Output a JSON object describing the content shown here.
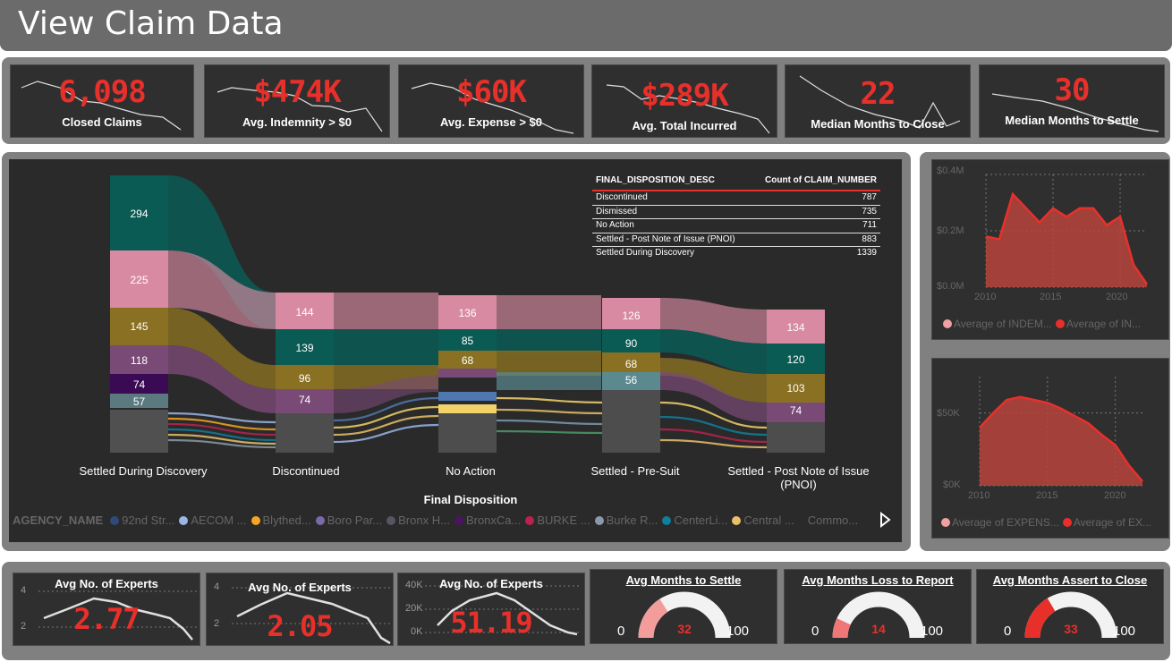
{
  "header": {
    "title": "View Claim Data"
  },
  "kpis": [
    {
      "value": "6,098",
      "label": "Closed Claims"
    },
    {
      "value": "$474K",
      "label": "Avg. Indemnity > $0"
    },
    {
      "value": "$60K",
      "label": "Avg. Expense > $0"
    },
    {
      "value": "$289K",
      "label": "Avg. Total Incurred"
    },
    {
      "value": "22",
      "label": "Median Months to Close"
    },
    {
      "value": "30",
      "label": "Median Months to Settle"
    }
  ],
  "sankey": {
    "x_axis_title": "Final Disposition",
    "columns": [
      "Settled During Discovery",
      "Discontinued",
      "No Action",
      "Settled - Pre-Suit",
      "Settled - Post Note of Issue (PNOI)"
    ],
    "node_values": {
      "col0": [
        "294",
        "225",
        "145",
        "118",
        "74",
        "57"
      ],
      "col1": [
        "144",
        "139",
        "96",
        "74"
      ],
      "col2": [
        "136",
        "85",
        "68"
      ],
      "col3": [
        "126",
        "90",
        "68",
        "56"
      ],
      "col4": [
        "134",
        "120",
        "103",
        "74"
      ]
    }
  },
  "disposition_table": {
    "headers": [
      "FINAL_DISPOSITION_DESC",
      "Count of CLAIM_NUMBER"
    ],
    "rows": [
      [
        "Discontinued",
        "787"
      ],
      [
        "Dismissed",
        "735"
      ],
      [
        "No Action",
        "711"
      ],
      [
        "Settled - Post Note of Issue (PNOI)",
        "883"
      ],
      [
        "Settled During Discovery",
        "1339"
      ]
    ]
  },
  "agency_legend": {
    "title": "AGENCY_NAME",
    "items": [
      {
        "label": "92nd Str...",
        "color": "#2e4a7a"
      },
      {
        "label": "AECOM ...",
        "color": "#9bb5e6"
      },
      {
        "label": "Blythed...",
        "color": "#f5a623"
      },
      {
        "label": "Boro Par...",
        "color": "#7a6aa8"
      },
      {
        "label": "Bronx H...",
        "color": "#555566"
      },
      {
        "label": "BronxCa...",
        "color": "#4b1463"
      },
      {
        "label": "BURKE ...",
        "color": "#b8234f"
      },
      {
        "label": "Burke R...",
        "color": "#8a9aa8"
      },
      {
        "label": "CenterLi...",
        "color": "#0e7f9c"
      },
      {
        "label": "Central ...",
        "color": "#e8c06a"
      }
    ],
    "more": "Commo..."
  },
  "chart_data": [
    {
      "type": "area",
      "x": [
        2010,
        2011,
        2012,
        2013,
        2014,
        2015,
        2016,
        2017,
        2018,
        2019,
        2020,
        2021,
        2022
      ],
      "series": [
        {
          "name": "Average of INDEM...",
          "values": [
            0.18,
            0.17,
            0.33,
            0.28,
            0.23,
            0.28,
            0.25,
            0.28,
            0.28,
            0.22,
            0.25,
            0.08,
            0.01
          ]
        },
        {
          "name": "Average of IN...",
          "values": [
            0.18,
            0.17,
            0.33,
            0.28,
            0.23,
            0.28,
            0.25,
            0.28,
            0.28,
            0.22,
            0.25,
            0.08,
            0.01
          ]
        }
      ],
      "y_tick_labels": [
        "$0.0M",
        "$0.2M",
        "$0.4M"
      ],
      "x_tick_labels": [
        "2010",
        "2015",
        "2020"
      ],
      "ylim": [
        0,
        0.4
      ],
      "xlim": [
        2010,
        2022
      ],
      "grid": true,
      "legend": "bottom"
    },
    {
      "type": "area",
      "x": [
        2010,
        2011,
        2012,
        2013,
        2014,
        2015,
        2016,
        2017,
        2018,
        2019,
        2020,
        2021,
        2022
      ],
      "series": [
        {
          "name": "Average of EXPENS...",
          "values": [
            40,
            50,
            59,
            61,
            59,
            57,
            53,
            48,
            43,
            35,
            28,
            14,
            3
          ]
        },
        {
          "name": "Average of EX...",
          "values": [
            40,
            50,
            59,
            61,
            59,
            57,
            53,
            48,
            43,
            35,
            28,
            14,
            3
          ]
        }
      ],
      "y_tick_labels": [
        "$0K",
        "$50K"
      ],
      "x_tick_labels": [
        "2010",
        "2015",
        "2020"
      ],
      "ylim": [
        0,
        75
      ],
      "xlim": [
        2010,
        2022
      ],
      "grid": true,
      "legend": "bottom"
    }
  ],
  "expert_minis": [
    {
      "title": "Avg No. of Experts",
      "value": "2.77",
      "ticks": [
        "4",
        "2"
      ]
    },
    {
      "title": "Avg No. of Experts",
      "value": "2.05",
      "ticks": [
        "4",
        "2"
      ]
    },
    {
      "title": "Avg No. of Experts",
      "value": "51.19",
      "ticks": [
        "40K",
        "20K",
        "0K"
      ]
    }
  ],
  "gauges": [
    {
      "title": "Avg Months to Settle",
      "value": "32",
      "min": "0",
      "max": "100",
      "fraction": 0.32,
      "color": "#f39c9c"
    },
    {
      "title": "Avg Months Loss to Report",
      "value": "14",
      "min": "0",
      "max": "100",
      "fraction": 0.14,
      "color": "#f07777"
    },
    {
      "title": "Avg Months Assert to Close",
      "value": "33",
      "min": "0",
      "max": "100",
      "fraction": 0.33,
      "color": "#e8302b"
    }
  ],
  "colors": {
    "accent": "#e8302b",
    "panel": "#2f2f2f",
    "frame": "#808080"
  }
}
